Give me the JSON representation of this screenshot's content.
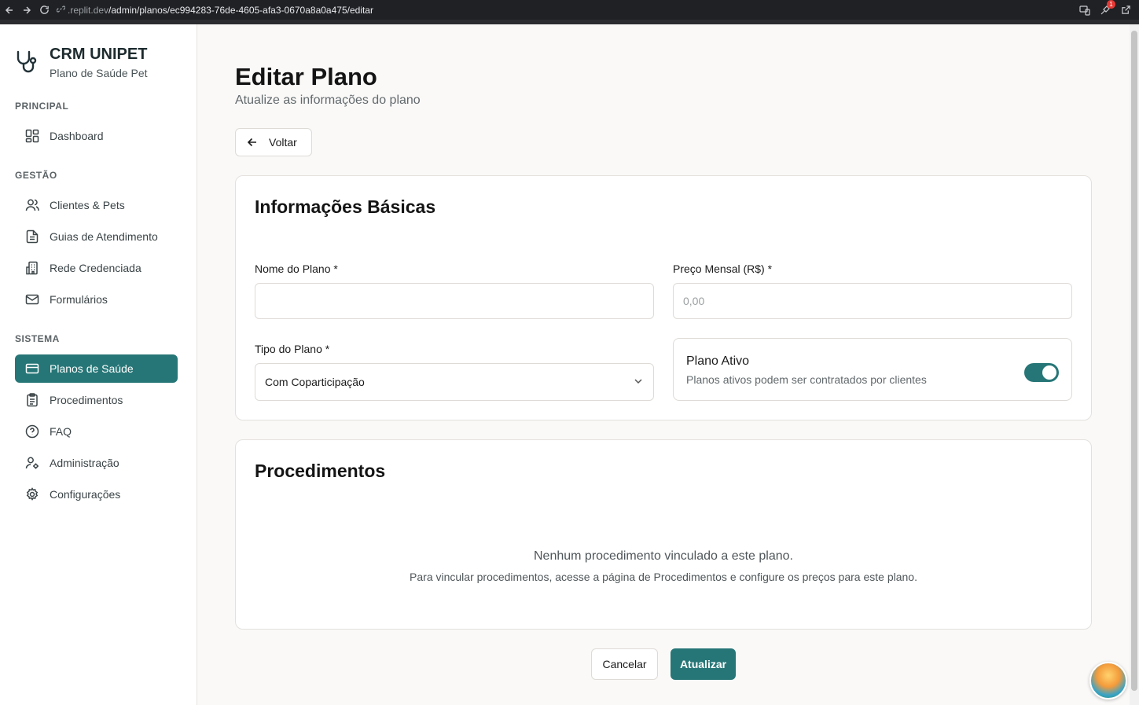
{
  "browser": {
    "url_host": ".replit.dev",
    "url_path": "/admin/planos/ec994283-76de-4605-afa3-0670a8a0a475/editar",
    "notification_count": "1"
  },
  "sidebar": {
    "brand_title": "CRM UNIPET",
    "brand_subtitle": "Plano de Saúde Pet",
    "sections": {
      "principal": "PRINCIPAL",
      "gestao": "GESTÃO",
      "sistema": "SISTEMA"
    },
    "items": [
      {
        "label": "Dashboard",
        "icon": "grid-icon"
      },
      {
        "label": "Clientes & Pets",
        "icon": "users-icon"
      },
      {
        "label": "Guias de Atendimento",
        "icon": "file-text-icon"
      },
      {
        "label": "Rede Credenciada",
        "icon": "building-icon"
      },
      {
        "label": "Formulários",
        "icon": "mail-icon"
      },
      {
        "label": "Planos de Saúde",
        "icon": "credit-card-icon",
        "active": true
      },
      {
        "label": "Procedimentos",
        "icon": "clipboard-icon"
      },
      {
        "label": "FAQ",
        "icon": "help-circle-icon"
      },
      {
        "label": "Administração",
        "icon": "user-cog-icon"
      },
      {
        "label": "Configurações",
        "icon": "settings-icon"
      }
    ]
  },
  "page": {
    "title": "Editar Plano",
    "subtitle": "Atualize as informações do plano",
    "back_label": "Voltar"
  },
  "basic_info": {
    "title": "Informações Básicas",
    "name_label": "Nome do Plano *",
    "name_value": "",
    "price_label": "Preço Mensal (R$) *",
    "price_placeholder": "0,00",
    "type_label": "Tipo do Plano *",
    "type_value": "Com Coparticipação",
    "active_title": "Plano Ativo",
    "active_desc": "Planos ativos podem ser contratados por clientes",
    "active_on": true
  },
  "procedures": {
    "title": "Procedimentos",
    "empty_title": "Nenhum procedimento vinculado a este plano.",
    "empty_desc": "Para vincular procedimentos, acesse a página de Procedimentos e configure os preços para este plano."
  },
  "actions": {
    "cancel_label": "Cancelar",
    "update_label": "Atualizar"
  },
  "colors": {
    "accent": "#277677",
    "background": "#faf9f8"
  }
}
